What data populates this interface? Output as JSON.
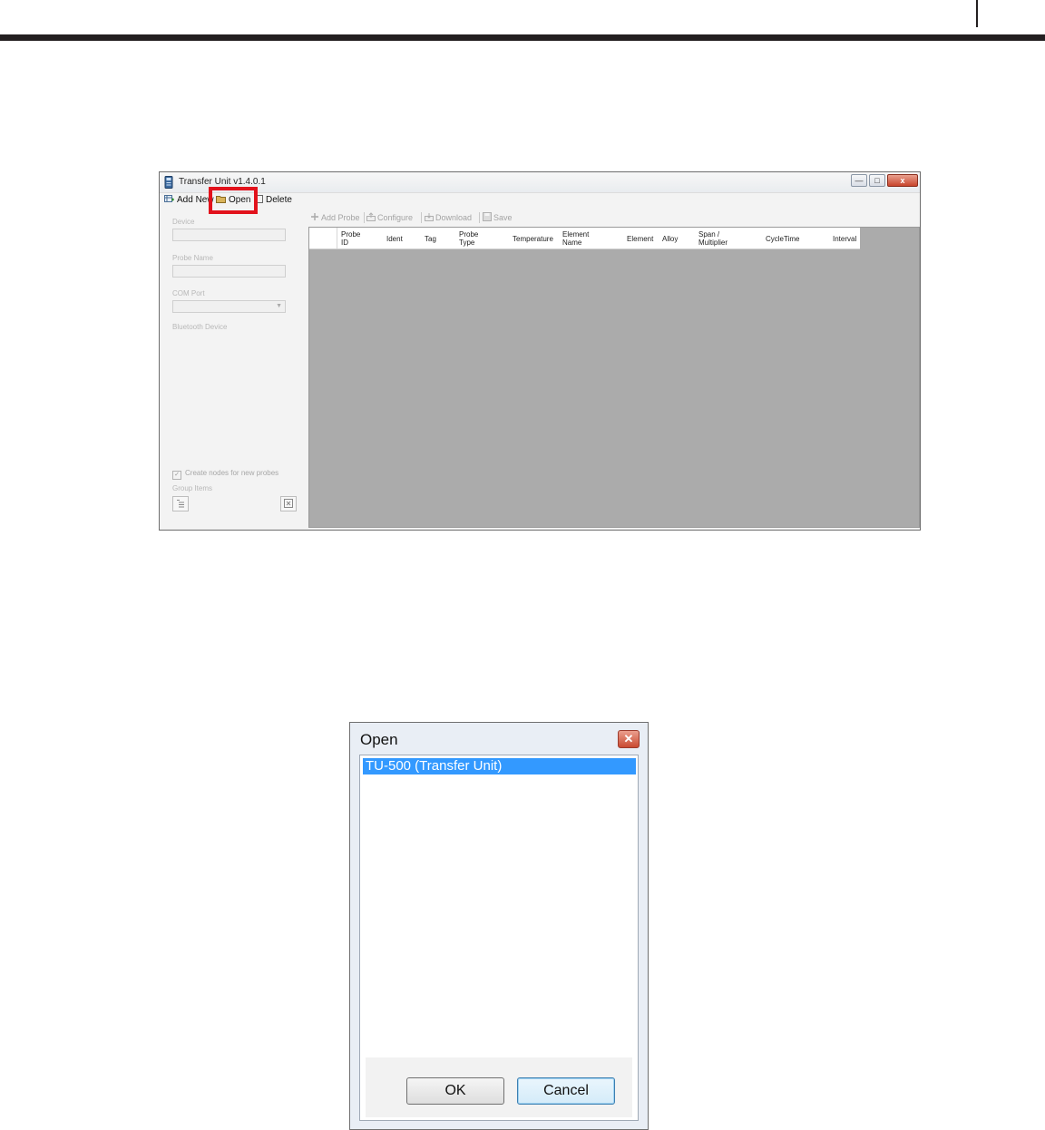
{
  "app": {
    "title": "Transfer Unit v1.4.0.1",
    "window_buttons": {
      "minimize": "—",
      "maximize": "□",
      "close": "x"
    }
  },
  "menu": {
    "add_new": "Add New",
    "open": "Open",
    "delete": "Delete"
  },
  "left_panel": {
    "device_label": "Device",
    "tag_label": "Probe Name",
    "com_port_label": "COM Port",
    "bluetooth_label": "Bluetooth Device",
    "create_nodes_label": "Create nodes for new probes",
    "group_label": "Group Items",
    "checkbox_mark": "✓"
  },
  "toolbar": {
    "add_probe": "Add Probe",
    "configure": "Configure",
    "download": "Download",
    "save": "Save"
  },
  "grid": {
    "columns": [
      {
        "line1": "Probe",
        "line2": "ID"
      },
      {
        "line1": "Ident",
        "line2": ""
      },
      {
        "line1": "Tag",
        "line2": ""
      },
      {
        "line1": "Probe",
        "line2": "Type"
      },
      {
        "line1": "Temperature",
        "line2": ""
      },
      {
        "line1": "Element",
        "line2": "Name"
      },
      {
        "line1": "Element",
        "line2": ""
      },
      {
        "line1": "Alloy",
        "line2": ""
      },
      {
        "line1": "Span /",
        "line2": "Multiplier"
      },
      {
        "line1": "CycleTime",
        "line2": ""
      },
      {
        "line1": "Interval",
        "line2": ""
      }
    ]
  },
  "open_dialog": {
    "title": "Open",
    "close_glyph": "✕",
    "items": [
      "TU-500 (Transfer Unit)"
    ],
    "ok": "OK",
    "cancel": "Cancel"
  }
}
